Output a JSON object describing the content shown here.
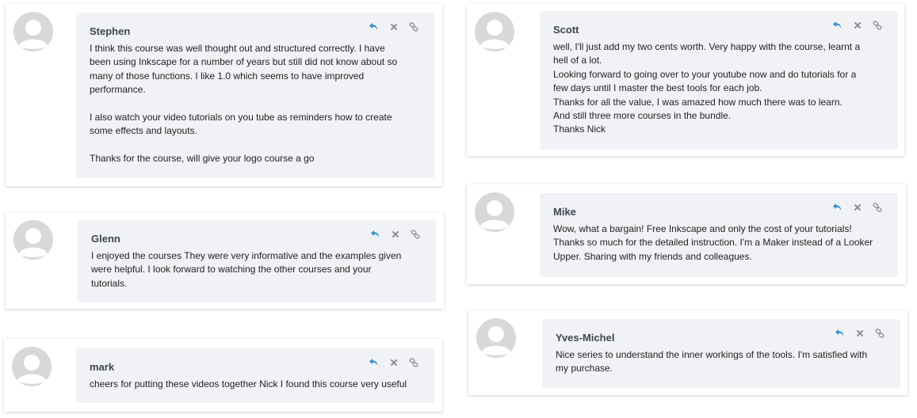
{
  "colors": {
    "accent": "#2e8fd1",
    "icon_gray": "#8b8f96",
    "bubble_bg": "#f1f2f5",
    "name_color": "#3d4451"
  },
  "icons": {
    "reply": "reply-arrow-icon",
    "delete": "close-x-icon",
    "permalink": "link-icon"
  },
  "comments": [
    {
      "author": "Stephen",
      "text": "I think this course was well thought out and structured correctly.  I have\nbeen using Inkscape for a number of years but still did not know about so\nmany of those functions.  I like 1.0 which seems to have improved\nperformance.\n\nI also watch your video tutorials on you tube as reminders how to create\nsome effects and layouts.\n\nThanks for the course, will give your logo course a go"
    },
    {
      "author": "Glenn",
      "text": "I enjoyed the courses They were very informative and the examples given\nwere helpful. I look forward to watching the other courses and your\ntutorials."
    },
    {
      "author": "mark",
      "text": "cheers for putting these videos together Nick I found this course very useful"
    },
    {
      "author": "Scott",
      "text": "well, I'll just add my two cents worth. Very happy with the course, learnt a\nhell of a lot.\nLooking forward to going over to your youtube now and do tutorials for a\nfew days until I master the best tools for each job.\nThanks for all the value, I was amazed how much there was to learn.\nAnd still three more courses in the bundle.\nThanks Nick"
    },
    {
      "author": "Mike",
      "text": "Wow, what a bargain!  Free Inkscape and only the cost of your tutorials!\nThanks so much for the detailed instruction. I'm a Maker instead of a Looker\nUpper. Sharing with my friends and colleagues."
    },
    {
      "author": "Yves-Michel",
      "text": "Nice series to understand the inner workings of the tools. I'm satisfied with\nmy purchase."
    }
  ]
}
